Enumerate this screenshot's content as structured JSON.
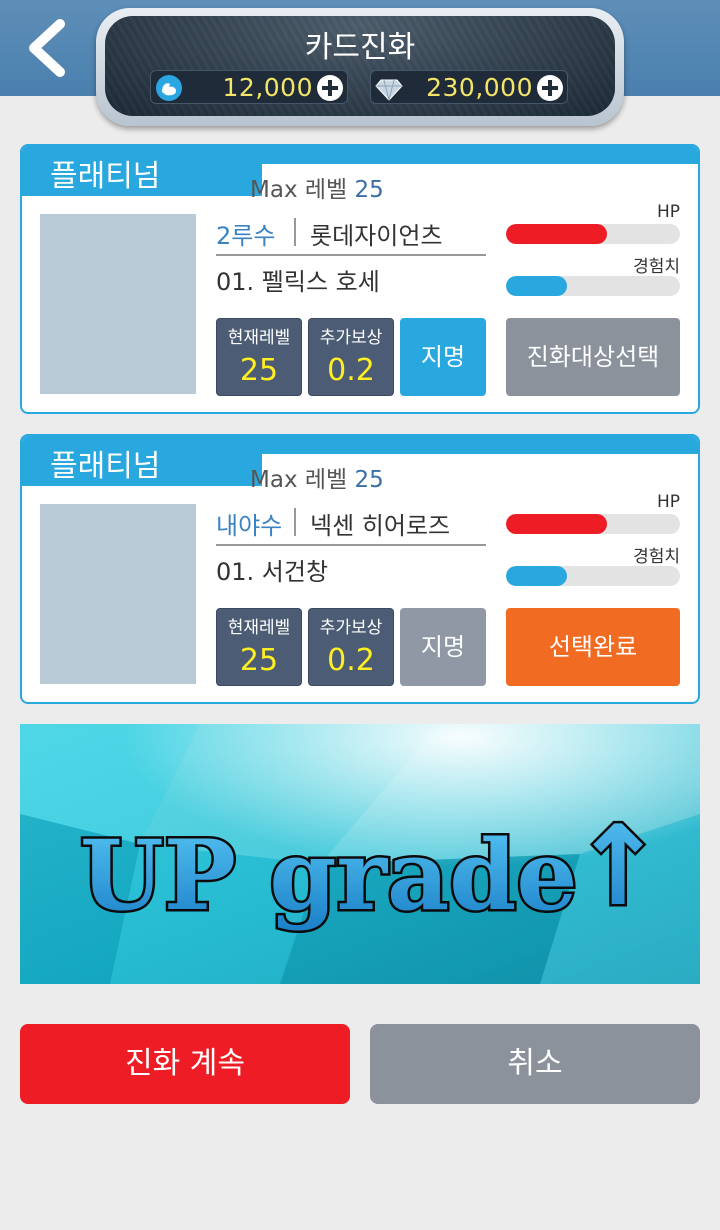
{
  "header": {
    "title": "카드진화",
    "currency": [
      {
        "icon": "muscle-icon",
        "value": "12,000"
      },
      {
        "icon": "diamond-icon",
        "value": "230,000"
      }
    ]
  },
  "cards": [
    {
      "grade": "플래티넘",
      "max_level_label": "Max 레벨",
      "max_level": "25",
      "position": "2루수",
      "team": "롯데자이언츠",
      "player": "01. 펠릭스 호세",
      "stats": [
        {
          "label": "현재레벨",
          "value": "25"
        },
        {
          "label": "추가보상",
          "value": "0.2"
        }
      ],
      "nominate_label": "지명",
      "hp_label": "HP",
      "exp_label": "경험치",
      "hp_fraction": 0.58,
      "exp_fraction": 0.35,
      "action_label": "진화대상선택"
    },
    {
      "grade": "플래티넘",
      "max_level_label": "Max 레벨",
      "max_level": "25",
      "position": "내야수",
      "team": "넥센 히어로즈",
      "player": "01. 서건창",
      "stats": [
        {
          "label": "현재레벨",
          "value": "25"
        },
        {
          "label": "추가보상",
          "value": "0.2"
        }
      ],
      "nominate_label": "지명",
      "hp_label": "HP",
      "exp_label": "경험치",
      "hp_fraction": 0.58,
      "exp_fraction": 0.35,
      "action_label": "선택완료"
    }
  ],
  "banner": {
    "text": "UP grade",
    "arrow": "↑"
  },
  "buttons": {
    "continue": "진화 계속",
    "cancel": "취소"
  },
  "colors": {
    "accent_blue": "#29a8df",
    "hp_red": "#ee1c24",
    "exp_blue": "#29a8df",
    "confirm_orange": "#f26b22",
    "gold_text": "#ffee22"
  }
}
